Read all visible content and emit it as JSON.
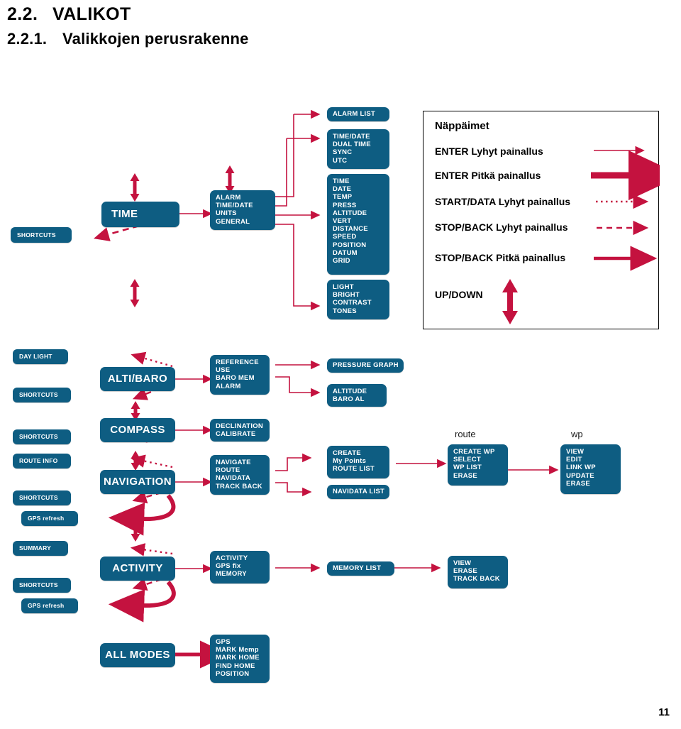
{
  "page": {
    "heading1_num": "2.2.",
    "heading1_text": "VALIKOT",
    "heading2_num": "2.2.1.",
    "heading2_text": "Valikkojen perusrakenne",
    "page_number": "11"
  },
  "colors": {
    "box_blue": "#0e5d82",
    "arrow_red": "#c4123f",
    "text_white": "#ffffff",
    "page_background": "#ffffff"
  },
  "legend": {
    "title": "Näppäimet",
    "rows": [
      {
        "label": "ENTER Lyhyt painallus",
        "style": "thin-solid-arrow"
      },
      {
        "label": "ENTER Pitkä painallus",
        "style": "thick-solid-arrow"
      },
      {
        "label": "START/DATA Lyhyt painallus",
        "style": "dotted-arrow"
      },
      {
        "label": "STOP/BACK Lyhyt painallus",
        "style": "dashed-arrow"
      },
      {
        "label": "STOP/BACK Pitkä painallus",
        "style": "medium-solid-arrow"
      },
      {
        "label": "UP/DOWN",
        "style": "up-down-double-arrow"
      }
    ]
  },
  "captions": {
    "route": "route",
    "wp": "wp"
  },
  "boxes": {
    "shortcuts_time": {
      "label": "SHORTCUTS"
    },
    "time": {
      "label": "TIME"
    },
    "time_menu": {
      "lines": [
        "ALARM",
        "TIME/DATE",
        "UNITS",
        "GENERAL"
      ]
    },
    "alarm_list": {
      "label": "ALARM LIST"
    },
    "time_date_sub": {
      "lines": [
        "TIME/DATE",
        "DUAL TIME",
        "SYNC",
        "UTC"
      ]
    },
    "units_sub": {
      "lines": [
        "TIME",
        "DATE",
        "TEMP",
        "PRESS",
        "ALTITUDE",
        "VERT",
        "DISTANCE",
        "SPEED",
        "POSITION",
        "DATUM",
        "GRID"
      ]
    },
    "general_sub": {
      "lines": [
        "LIGHT",
        "BRIGHT",
        "CONTRAST",
        "TONES"
      ]
    },
    "day_light": {
      "label": "DAY LIGHT"
    },
    "shortcuts_alti": {
      "label": "SHORTCUTS"
    },
    "altibaro": {
      "label": "ALTI/BARO"
    },
    "altibaro_menu": {
      "lines": [
        "REFERENCE",
        "USE",
        "BARO MEM",
        "ALARM"
      ]
    },
    "pressure_graph": {
      "label": "PRESSURE GRAPH"
    },
    "altitude_baroal": {
      "lines": [
        "ALTITUDE",
        "BARO AL"
      ]
    },
    "shortcuts_compass": {
      "label": "SHORTCUTS"
    },
    "compass": {
      "label": "COMPASS"
    },
    "compass_menu": {
      "lines": [
        "DECLINATION",
        "CALIBRATE"
      ]
    },
    "route_info": {
      "label": "ROUTE INFO"
    },
    "shortcuts_nav": {
      "label": "SHORTCUTS"
    },
    "gps_refresh_nav": {
      "label": "GPS refresh"
    },
    "navigation": {
      "label": "NAVIGATION"
    },
    "navigation_menu": {
      "lines": [
        "NAVIGATE",
        "ROUTE",
        "NAVIDATA",
        "TRACK BACK"
      ]
    },
    "route_create": {
      "lines": [
        "CREATE",
        "My Points",
        "ROUTE LIST"
      ]
    },
    "navidata_list": {
      "label": "NAVIDATA LIST"
    },
    "route_col": {
      "lines": [
        "CREATE WP",
        "SELECT",
        "WP LIST",
        "ERASE"
      ]
    },
    "wp_col": {
      "lines": [
        "VIEW",
        "EDIT",
        "LINK WP",
        "UPDATE",
        "ERASE"
      ]
    },
    "summary": {
      "label": "SUMMARY"
    },
    "shortcuts_act": {
      "label": "SHORTCUTS"
    },
    "gps_refresh_act": {
      "label": "GPS refresh"
    },
    "activity": {
      "label": "ACTIVITY"
    },
    "activity_menu": {
      "lines": [
        "ACTIVITY",
        "GPS fix",
        "MEMORY"
      ]
    },
    "memory_list": {
      "label": "MEMORY LIST"
    },
    "memory_sub": {
      "lines": [
        "VIEW",
        "ERASE",
        "TRACK BACK"
      ]
    },
    "all_modes": {
      "label": "ALL MODES"
    },
    "all_modes_menu": {
      "lines": [
        "GPS",
        "MARK Memp",
        "MARK HOME",
        "FIND HOME",
        "POSITION"
      ]
    }
  }
}
